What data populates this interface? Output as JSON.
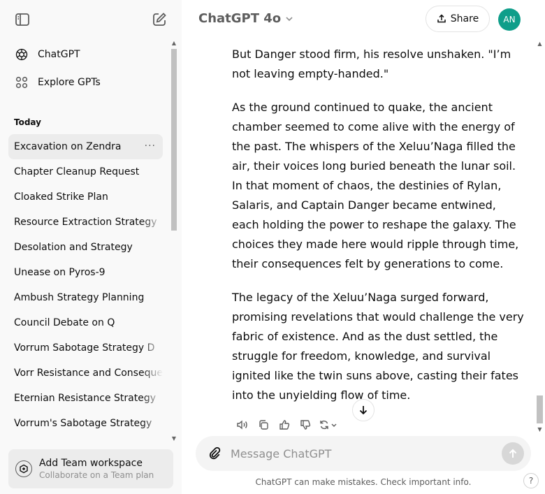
{
  "sidebar": {
    "nav": [
      {
        "label": "ChatGPT",
        "icon": "openai-logo-icon"
      },
      {
        "label": "Explore GPTs",
        "icon": "grid-icon"
      }
    ],
    "section_title": "Today",
    "history": [
      "Excavation on Zendra",
      "Chapter Cleanup Request",
      "Cloaked Strike Plan",
      "Resource Extraction Strategy",
      "Desolation and Strategy",
      "Unease on Pyros-9",
      "Ambush Strategy Planning",
      "Council Debate on Q",
      "Vorrum Sabotage Strategy D",
      "Vorr Resistance and Consequences",
      "Eternian Resistance Strategy",
      "Vorrum's Sabotage Strategy"
    ],
    "more_label": "···",
    "team": {
      "title": "Add Team workspace",
      "subtitle": "Collaborate on a Team plan"
    }
  },
  "header": {
    "model": "ChatGPT 4o",
    "share_label": "Share",
    "avatar_initials": "AN"
  },
  "message": {
    "paragraphs": [
      "But Danger stood firm, his resolve unshaken. \"I’m not leaving empty-handed.\"",
      "As the ground continued to quake, the ancient chamber seemed to come alive with the energy of the past. The whispers of the Xeluu’Naga filled the air, their voices long buried beneath the lunar soil. In that moment of chaos, the destinies of Rylan, Salaris, and Captain Danger became entwined, each holding the power to reshape the galaxy. The choices they made here would ripple through time, their consequences felt by generations to come.",
      "The legacy of the Xeluu’Naga surged forward, promising revelations that would challenge the very fabric of existence. And as the dust settled, the struggle for freedom, knowledge, and survival ignited like the twin suns above, casting their fates into the unyielding flow of time."
    ]
  },
  "composer": {
    "placeholder": "Message ChatGPT"
  },
  "disclaimer": "ChatGPT can make mistakes. Check important info.",
  "help_label": "?",
  "colors": {
    "sidebar_bg": "#f9f9f9",
    "active_item_bg": "#ececec",
    "avatar_bg": "#0f9e8a",
    "composer_bg": "#f4f4f4"
  }
}
